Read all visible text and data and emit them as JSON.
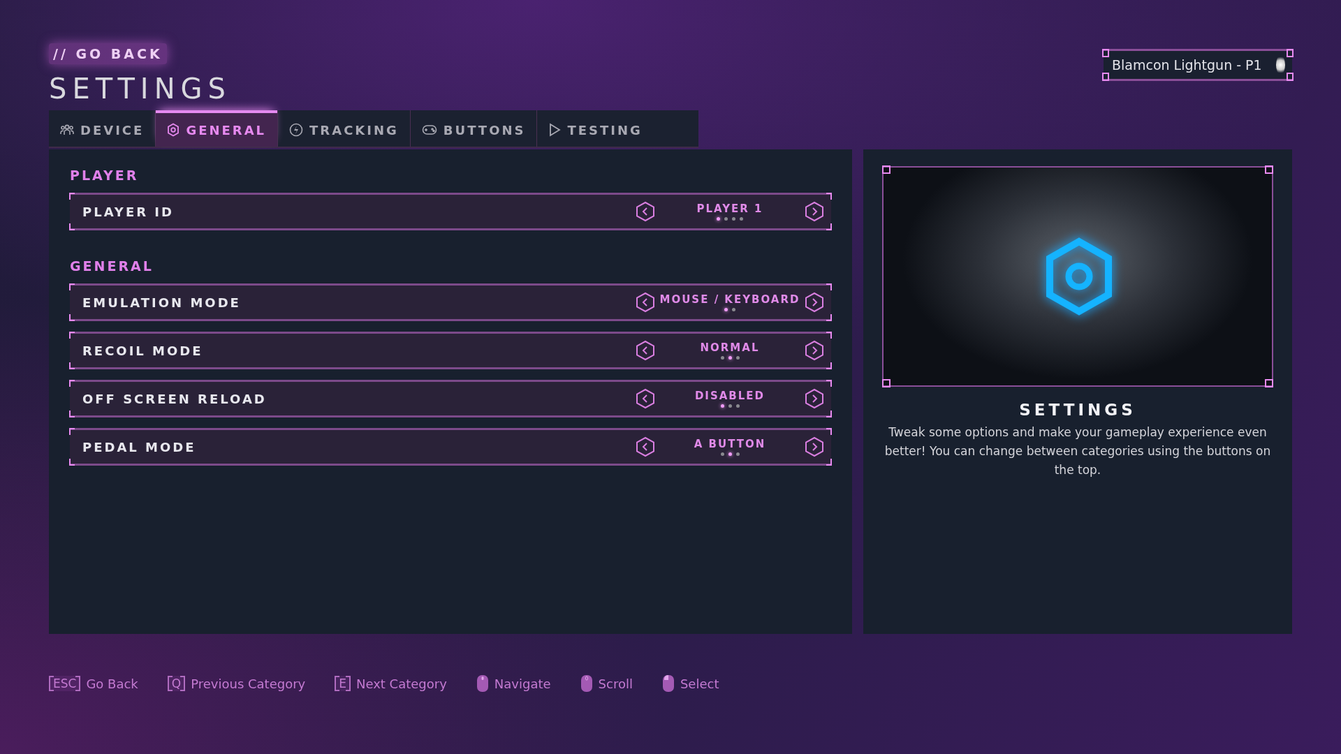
{
  "back_link": "// GO BACK",
  "title": "SETTINGS",
  "device": {
    "label": "Blamcon Lightgun - P1"
  },
  "tabs": [
    {
      "label": "DEVICE",
      "selected": false
    },
    {
      "label": "GENERAL",
      "selected": true
    },
    {
      "label": "TRACKING",
      "selected": false
    },
    {
      "label": "BUTTONS",
      "selected": false
    },
    {
      "label": "TESTING",
      "selected": false
    }
  ],
  "sections": [
    {
      "heading": "PLAYER",
      "rows": [
        {
          "label": "PLAYER ID",
          "value": "PLAYER 1",
          "options": [
            {
              "selected": true
            },
            {
              "selected": false
            },
            {
              "selected": false
            },
            {
              "selected": false
            }
          ]
        }
      ]
    },
    {
      "heading": "GENERAL",
      "rows": [
        {
          "label": "EMULATION MODE",
          "value": "MOUSE / KEYBOARD",
          "options": [
            {
              "selected": true
            },
            {
              "selected": false
            }
          ]
        },
        {
          "label": "RECOIL MODE",
          "value": "NORMAL",
          "options": [
            {
              "selected": false
            },
            {
              "selected": true
            },
            {
              "selected": false
            }
          ]
        },
        {
          "label": "OFF SCREEN RELOAD",
          "value": "DISABLED",
          "options": [
            {
              "selected": true
            },
            {
              "selected": false
            },
            {
              "selected": false
            }
          ]
        },
        {
          "label": "PEDAL MODE",
          "value": "A BUTTON",
          "options": [
            {
              "selected": false
            },
            {
              "selected": true
            },
            {
              "selected": false
            }
          ]
        }
      ]
    }
  ],
  "info": {
    "title": "SETTINGS",
    "description": "Tweak some options and make your gameplay experience even better! You can change between categories using the buttons on the top."
  },
  "hints": [
    {
      "kind": "key",
      "key": "ESC",
      "label": "Go Back"
    },
    {
      "kind": "key",
      "key": "Q",
      "label": "Previous Category"
    },
    {
      "kind": "key",
      "key": "E",
      "label": "Next Category"
    },
    {
      "kind": "mouse",
      "label": "Navigate"
    },
    {
      "kind": "mouse",
      "label": "Scroll"
    },
    {
      "kind": "mouse",
      "label": "Select"
    }
  ]
}
